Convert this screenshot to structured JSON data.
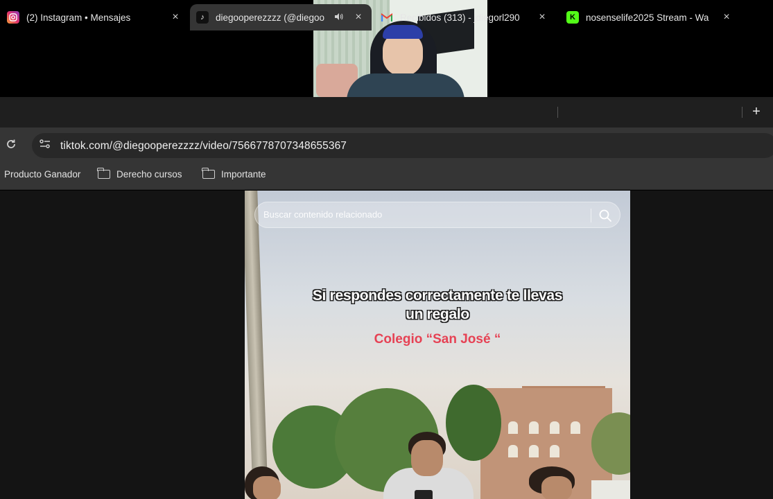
{
  "tabs": [
    {
      "title": "(2) Instagram • Mensajes",
      "icon": "instagram-icon"
    },
    {
      "title": "diegooperezzzz (@diegoo",
      "icon": "tiktok-icon",
      "audio": "speaker-icon"
    },
    {
      "title": "Recibidos (313) - jdiegorl290",
      "icon": "gmail-icon"
    },
    {
      "title": "nosenselife2025 Stream - Wa",
      "icon": "kick-icon"
    }
  ],
  "tab_close": "×",
  "new_tab": "+",
  "address": {
    "url": "tiktok.com/@diegooperezzzz/video/7566778707348655367"
  },
  "bookmarks": [
    {
      "label": "Producto Ganador"
    },
    {
      "label": "Derecho cursos"
    },
    {
      "label": "Importante"
    }
  ],
  "video": {
    "search_placeholder": "Buscar contenido relacionado",
    "caption_line1": "Si respondes correctamente te llevas",
    "caption_line2": "un regalo",
    "location_text": "Colegio “San José “",
    "caption_color": "#ffffff",
    "location_color": "#e64254"
  },
  "colors": {
    "tab_bar": "#1f1f1f",
    "active_tab": "#353535",
    "omnibox": "#282828",
    "page_bg": "#141414"
  }
}
